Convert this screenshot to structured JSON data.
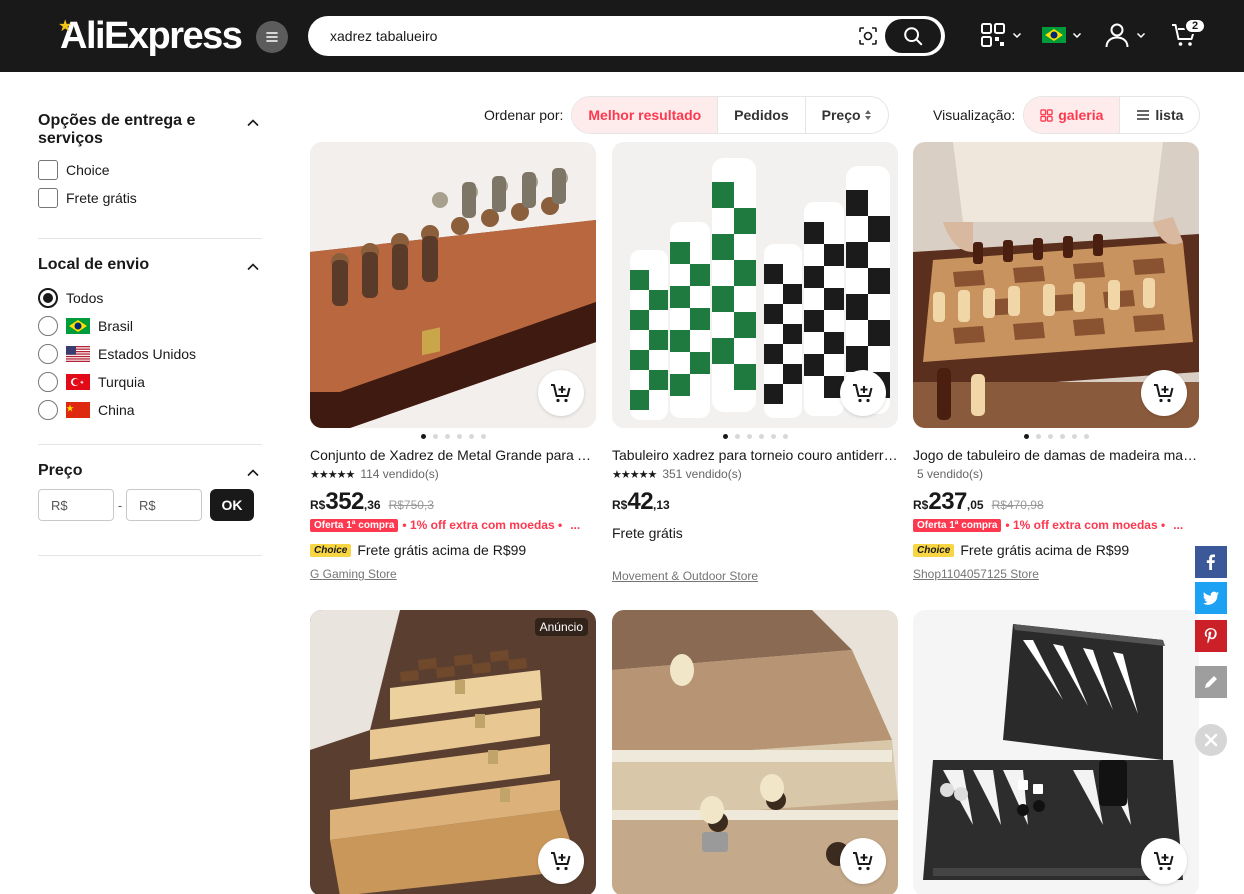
{
  "header": {
    "logo": "AliExpress",
    "search_value": "xadrez tabalueiro",
    "cart_count": "2",
    "country_flag": "brazil-flag-icon"
  },
  "sidebar": {
    "delivery": {
      "title": "Opções de entrega e serviços",
      "options": [
        "Choice",
        "Frete grátis"
      ]
    },
    "location": {
      "title": "Local de envio",
      "options": [
        "Todos",
        "Brasil",
        "Estados Unidos",
        "Turquia",
        "China"
      ],
      "selected": "Todos"
    },
    "price": {
      "title": "Preço",
      "min_placeholder": "R$",
      "separator": "-",
      "max_placeholder": "R$",
      "ok_label": "OK"
    }
  },
  "sort": {
    "label": "Ordenar por:",
    "options": [
      "Melhor resultado",
      "Pedidos",
      "Preço"
    ],
    "active": "Melhor resultado"
  },
  "view": {
    "label": "Visualização:",
    "gallery": "galeria",
    "list": "lista",
    "active": "galeria"
  },
  "products": [
    {
      "title": "Conjunto de Xadrez de Metal Grande para Adultos",
      "stars": "★★★★★",
      "sold": "114 vendido(s)",
      "currency": "R$",
      "price_int": "352",
      "price_dec": ",36",
      "old_price": "R$750,3",
      "promo_badge": "Oferta 1ª compra",
      "promo_text": "• 1% off extra com moedas •",
      "promo_more": "...",
      "choice": "Choice",
      "shipping": "Frete grátis acima de R$99",
      "store": "G Gaming Store",
      "ad": ""
    },
    {
      "title": "Tabuleiro xadrez para torneio couro antiderrapante",
      "stars": "★★★★★",
      "sold": "351 vendido(s)",
      "currency": "R$",
      "price_int": "42",
      "price_dec": ",13",
      "old_price": "",
      "shipping": "Frete grátis",
      "store": "Movement & Outdoor Store",
      "ad": ""
    },
    {
      "title": "Jogo de tabuleiro de damas de madeira magnético",
      "stars": "",
      "sold": "5 vendido(s)",
      "currency": "R$",
      "price_int": "237",
      "price_dec": ",05",
      "old_price": "R$470,98",
      "promo_badge": "Oferta 1ª compra",
      "promo_text": "• 1% off extra com moedas •",
      "promo_more": "...",
      "choice": "Choice",
      "shipping": "Frete grátis acima de R$99",
      "store": "Shop1104057125 Store",
      "ad": ""
    },
    {
      "ad": "Anúncio"
    },
    {
      "ad": ""
    },
    {
      "ad": ""
    }
  ],
  "social": [
    "facebook-icon",
    "twitter-icon",
    "pinterest-icon",
    "edit-icon",
    "close-icon"
  ]
}
